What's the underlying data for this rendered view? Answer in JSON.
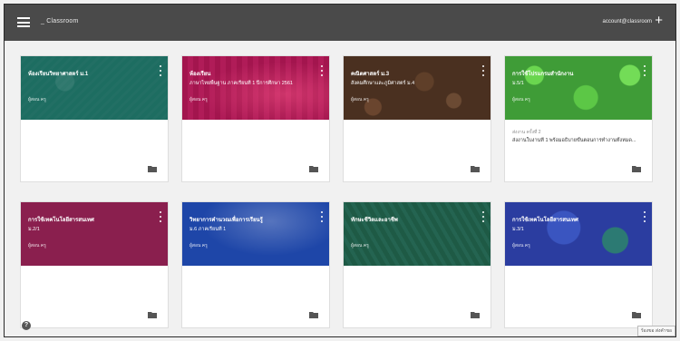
{
  "header": {
    "app_title": "_ Classroom",
    "account_text": "account@classroom",
    "plus_icon": "+",
    "menu_icon": "hamburger-menu-icon"
  },
  "cards": [
    {
      "title": "ห้องเรียนวิทยาศาสตร์ ม.1",
      "section": "",
      "teacher": "ผู้สอน ครู",
      "body_line1": "",
      "body_line2": "",
      "color": "#1f6b60"
    },
    {
      "title": "ห้องเรียน",
      "section": "ภาษาไทยพื้นฐาน ภาคเรียนที่ 1 ปีการศึกษา 2561",
      "teacher": "ผู้สอน ครู",
      "body_line1": "",
      "body_line2": "",
      "color": "#a8124f"
    },
    {
      "title": "คณิตศาสตร์ ม.3",
      "section": "สังคมศึกษาและภูมิศาสตร์ ม.4",
      "teacher": "ผู้สอน ครู",
      "body_line1": "",
      "body_line2": "",
      "color": "#4a3020"
    },
    {
      "title": "การใช้โปรแกรมสำนักงาน",
      "section": "ม.5/1",
      "teacher": "ผู้สอน ครู",
      "body_line1": "ส่งงาน ครั้งที่ 2",
      "body_line2": "ส่งงานใบงานที่ 1 พร้อมอธิบายขั้นตอนการทำงานทั้งหมด...",
      "color": "#3f9c37"
    },
    {
      "title": "การใช้เทคโนโลยีสารสนเทศ",
      "section": "ม.2/1",
      "teacher": "ผู้สอน ครู",
      "body_line1": "",
      "body_line2": "",
      "color": "#8a1f4e"
    },
    {
      "title": "วิทยาการคำนวณเพื่อการเรียนรู้",
      "section": "ม.6 ภาคเรียนที่ 1",
      "teacher": "ผู้สอน ครู",
      "body_line1": "",
      "body_line2": "",
      "color": "#1e46a8"
    },
    {
      "title": "ทักษะชีวิตและอาชีพ",
      "section": "",
      "teacher": "ผู้สอน ครู",
      "body_line1": "",
      "body_line2": "",
      "color": "#1f5846"
    },
    {
      "title": "การใช้เทคโนโลยีสารสนเทศ",
      "section": "ม.3/1",
      "teacher": "ผู้สอน ครู",
      "body_line1": "",
      "body_line2": "",
      "color": "#2b3da0"
    }
  ],
  "help_icon": "?",
  "status_tooltip": "ร้องขอ ส่งคำขอ"
}
